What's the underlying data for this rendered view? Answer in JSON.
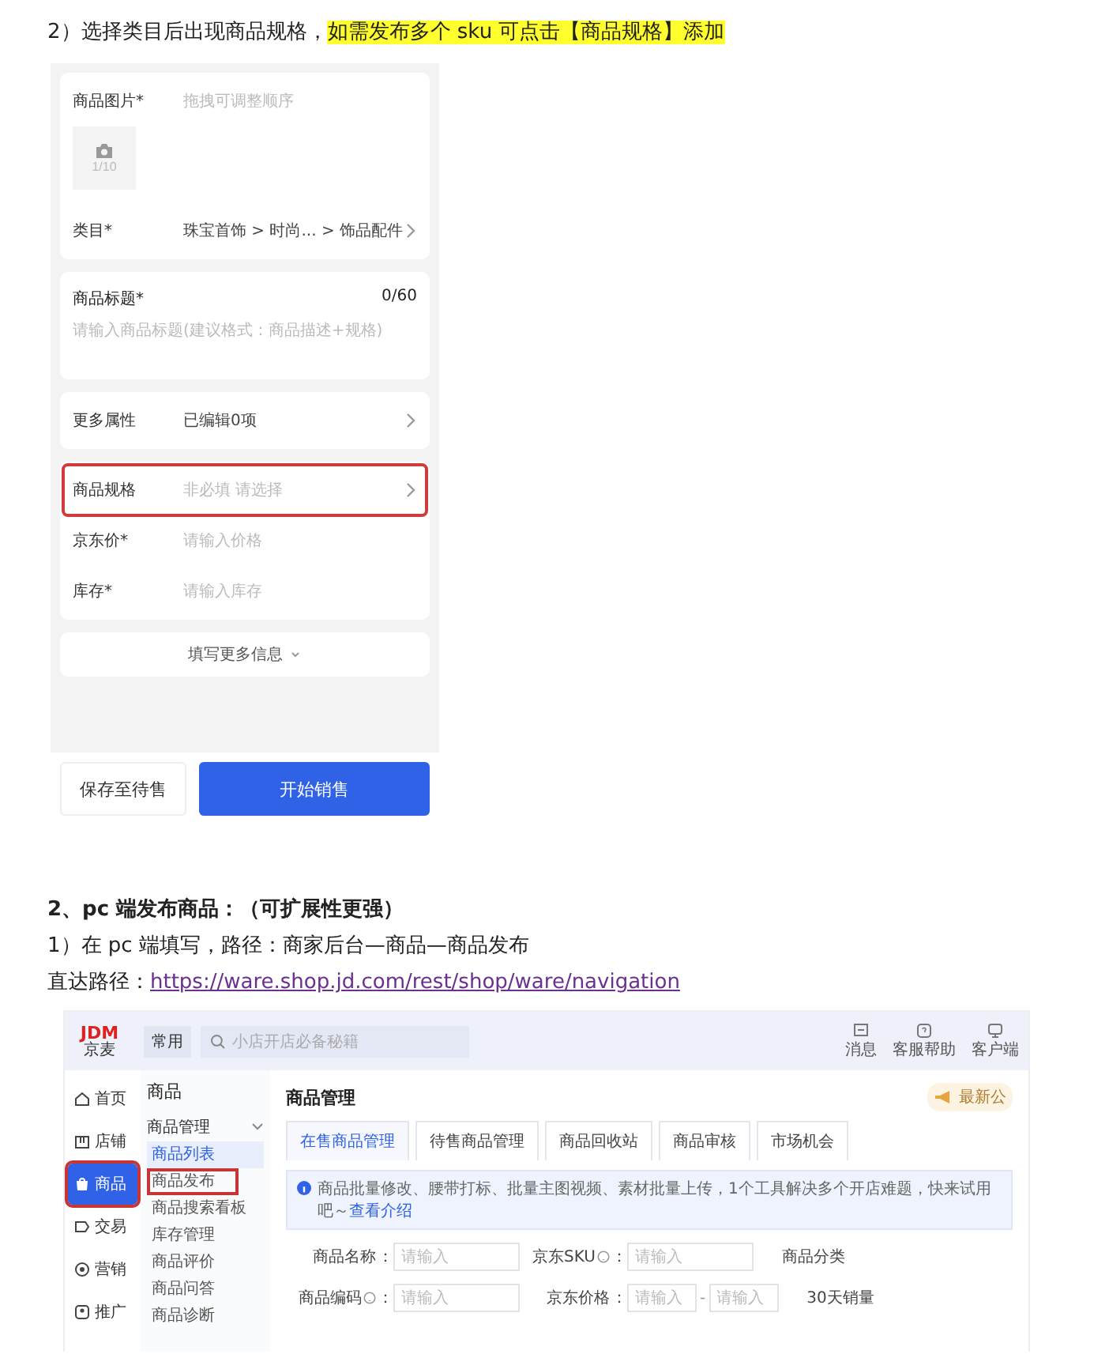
{
  "step_heading": [
    {
      "text": "2）选择类目后出现商品规格，",
      "highlighted": false
    },
    {
      "text": "如需发布多个 sku 可点击【商品规格】添加",
      "highlighted": true
    }
  ],
  "mobile": {
    "cards": [
      {
        "rows": [
          {
            "kind": "photo",
            "label": "商品图片*",
            "hint": "拖拽可调整顺序",
            "counter": "1/10",
            "highlighted": false
          },
          {
            "kind": "select",
            "label": "类目*",
            "value": "珠宝首饰 > 时尚... > 饰品配件",
            "highlighted": false
          }
        ]
      },
      {
        "rows": [
          {
            "kind": "textarea",
            "label": "商品标题*",
            "counter": "0/60",
            "placeholder": "请输入商品标题(建议格式：商品描述+规格)",
            "highlighted": false
          }
        ]
      },
      {
        "rows": [
          {
            "kind": "select",
            "label": "更多属性",
            "value": "已编辑0项",
            "highlighted": false
          }
        ]
      },
      {
        "rows": [
          {
            "kind": "select",
            "label": "商品规格",
            "placeholder": "非必填 请选择",
            "highlighted": true
          },
          {
            "kind": "input",
            "label": "京东价*",
            "placeholder": "请输入价格",
            "highlighted": false
          },
          {
            "kind": "input",
            "label": "库存*",
            "placeholder": "请输入库存",
            "highlighted": false
          }
        ]
      },
      {
        "rows": [
          {
            "kind": "expand",
            "label": "填写更多信息",
            "highlighted": false
          }
        ]
      }
    ],
    "buttons": [
      {
        "label": "保存至待售",
        "kind": "secondary"
      },
      {
        "label": "开始销售",
        "kind": "primary"
      }
    ]
  },
  "section2": {
    "heading": "2、pc 端发布商品：（可扩展性更强）",
    "step": "1）在 pc 端填写，路径：商家后台—商品—商品发布",
    "link_prefix": "直达路径：",
    "link": "https://ware.shop.jd.com/rest/shop/ware/navigation"
  },
  "pc": {
    "logo_top": "JDM",
    "logo_bottom": "京麦",
    "top_tab": "常用",
    "search_placeholder": "小店开店必备秘籍",
    "tools": [
      {
        "label": "消息"
      },
      {
        "label": "客服帮助"
      },
      {
        "label": "客户端"
      }
    ],
    "nav": [
      {
        "label": "首页",
        "selected": false,
        "highlighted": false
      },
      {
        "label": "店铺",
        "selected": false,
        "highlighted": false
      },
      {
        "label": "商品",
        "selected": true,
        "highlighted": true
      },
      {
        "label": "交易",
        "selected": false,
        "highlighted": false
      },
      {
        "label": "营销",
        "selected": false,
        "highlighted": false
      },
      {
        "label": "推广",
        "selected": false,
        "highlighted": false
      }
    ],
    "subnav": {
      "title": "商品",
      "group": "商品管理",
      "expanded": true,
      "items": [
        {
          "label": "商品列表",
          "selected": true,
          "highlighted": false
        },
        {
          "label": "商品发布",
          "selected": false,
          "highlighted": true
        },
        {
          "label": "商品搜索看板",
          "selected": false,
          "highlighted": false
        },
        {
          "label": "库存管理",
          "selected": false,
          "highlighted": false
        },
        {
          "label": "商品评价",
          "selected": false,
          "highlighted": false
        },
        {
          "label": "商品问答",
          "selected": false,
          "highlighted": false
        },
        {
          "label": "商品诊断",
          "selected": false,
          "highlighted": false
        }
      ]
    },
    "main": {
      "title": "商品管理",
      "notice": "最新公",
      "tabs": [
        {
          "label": "在售商品管理",
          "selected": true
        },
        {
          "label": "待售商品管理",
          "selected": false
        },
        {
          "label": "商品回收站",
          "selected": false
        },
        {
          "label": "商品审核",
          "selected": false
        },
        {
          "label": "市场机会",
          "selected": false
        }
      ],
      "info": {
        "text": "商品批量修改、腰带打标、批量主图视频、素材批量上传，1个工具解决多个开店难题，快来试用吧～",
        "link": "查看介绍"
      },
      "form_rows": [
        [
          {
            "label": "商品名称",
            "help": false,
            "colon": "：",
            "placeholders": [
              "请输入"
            ]
          },
          {
            "label": "京东SKU",
            "help": true,
            "colon": "：",
            "placeholders": [
              "请输入"
            ]
          },
          {
            "label": "商品分类"
          }
        ],
        [
          {
            "label": "商品编码",
            "help": true,
            "colon": "：",
            "placeholders": [
              "请输入"
            ]
          },
          {
            "label": "京东价格",
            "help": false,
            "colon": "：",
            "placeholders": [
              "请输入",
              "请输入"
            ],
            "separator": "-"
          },
          {
            "label": "30天销量"
          }
        ]
      ]
    }
  }
}
